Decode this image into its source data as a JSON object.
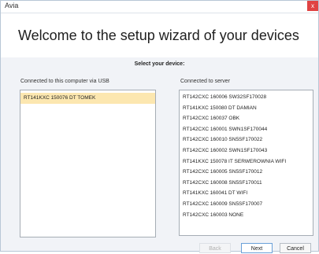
{
  "window": {
    "title": "Avia",
    "close_glyph": "x"
  },
  "header": {
    "title": "Welcome to the setup wizard of your devices"
  },
  "main": {
    "select_label": "Select your device:",
    "local": {
      "label": "Connected to this computer via USB",
      "items": [
        "RT141KXC 150076 DT TOMEK"
      ],
      "selected_index": 0
    },
    "server": {
      "label": "Connected to server",
      "items": [
        "RT142CXC 160006 SW32SF170028",
        "RT141KXC 150080 DT DAMIAN",
        "RT142CXC 160037 OBK",
        "RT142CXC 160001 SWN1SF170044",
        "RT142CXC 160010 SN5SF170022",
        "RT142CXC 160002 SWN1SF170043",
        "RT141KXC 150078 IT SERWEROWNIA WIFI",
        "RT142CXC 160005 SN5SF170012",
        "RT142CXC 160008 SN5SF170011",
        "RT141KXC 160041 DT WIFI",
        "RT142CXC 160009 SN5SF170007",
        "RT142CXC 160003 NONE"
      ]
    }
  },
  "footer": {
    "back_label": "Back",
    "next_label": "Next",
    "cancel_label": "Cancel"
  },
  "colors": {
    "selection": "#fce7b0",
    "close_button": "#e04343",
    "content_bg": "#f1f3f7"
  }
}
